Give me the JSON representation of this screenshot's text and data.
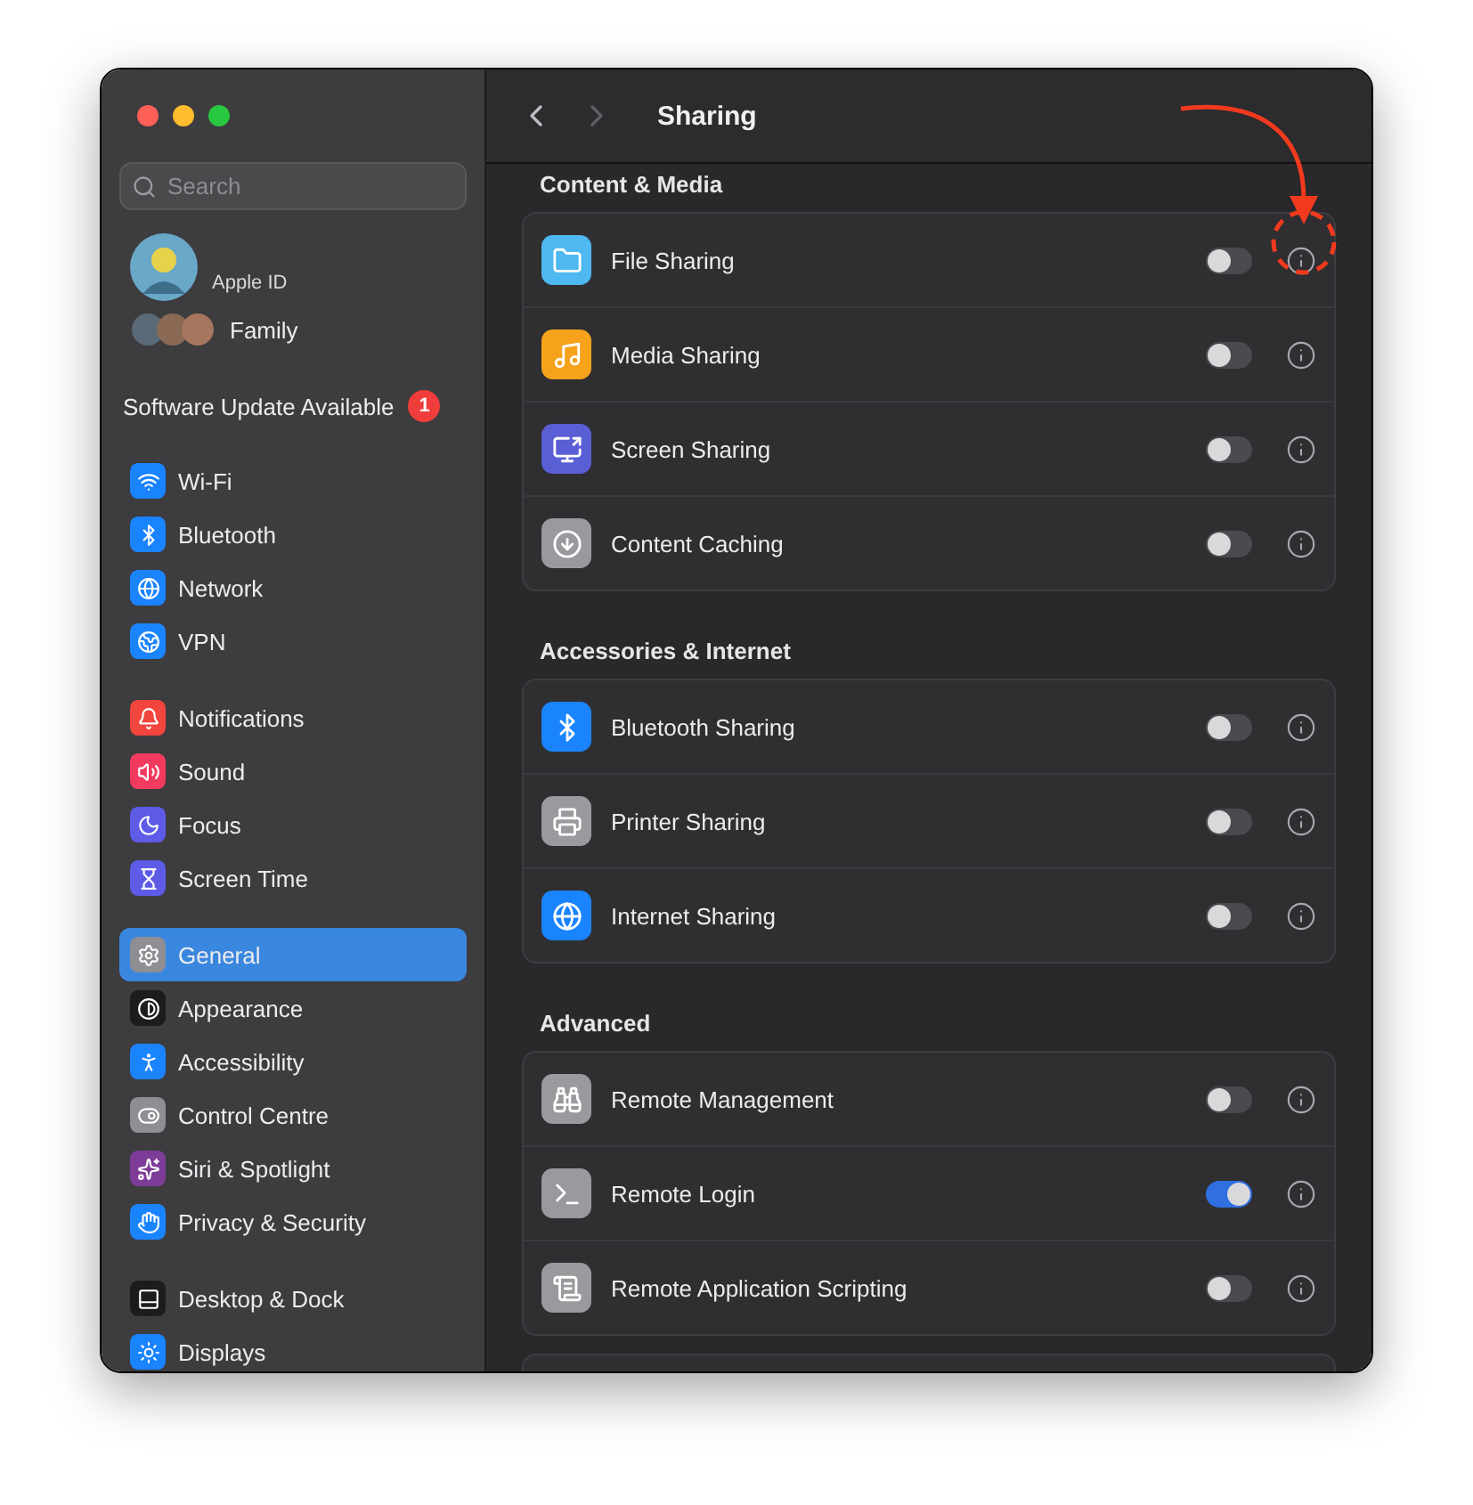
{
  "sidebar": {
    "search": {
      "placeholder": "Search"
    },
    "account": {
      "label": "Apple ID"
    },
    "family": {
      "label": "Family"
    },
    "update": {
      "label": "Software Update Available",
      "badge": "1"
    },
    "groups": [
      [
        {
          "label": "Wi-Fi",
          "kind": "wifi",
          "color": "#1a84ff",
          "selected": false
        },
        {
          "label": "Bluetooth",
          "kind": "bluetooth",
          "color": "#1a84ff",
          "selected": false
        },
        {
          "label": "Network",
          "kind": "globe",
          "color": "#1a84ff",
          "selected": false
        },
        {
          "label": "VPN",
          "kind": "vpn",
          "color": "#1a84ff",
          "selected": false
        }
      ],
      [
        {
          "label": "Notifications",
          "kind": "bell",
          "color": "#f2453d",
          "selected": false
        },
        {
          "label": "Sound",
          "kind": "sound",
          "color": "#f23a5f",
          "selected": false
        },
        {
          "label": "Focus",
          "kind": "moon",
          "color": "#5e5ce6",
          "selected": false
        },
        {
          "label": "Screen Time",
          "kind": "hourglass",
          "color": "#5e5ce6",
          "selected": false
        }
      ],
      [
        {
          "label": "General",
          "kind": "gear",
          "color": "#8e8e93",
          "selected": true
        },
        {
          "label": "Appearance",
          "kind": "contrast",
          "color": "#1c1c1e",
          "selected": false
        },
        {
          "label": "Accessibility",
          "kind": "person",
          "color": "#1a84ff",
          "selected": false
        },
        {
          "label": "Control Centre",
          "kind": "toggles",
          "color": "#8e8e93",
          "selected": false
        },
        {
          "label": "Siri & Spotlight",
          "kind": "sparkles",
          "color": "#7d3c98",
          "selected": false
        },
        {
          "label": "Privacy & Security",
          "kind": "hand",
          "color": "#1a84ff",
          "selected": false
        }
      ],
      [
        {
          "label": "Desktop & Dock",
          "kind": "dock",
          "color": "#1c1c1e",
          "selected": false
        },
        {
          "label": "Displays",
          "kind": "sun",
          "color": "#1a84ff",
          "selected": false
        }
      ]
    ]
  },
  "header": {
    "title": "Sharing"
  },
  "sections": [
    {
      "title": "Content & Media",
      "rows": [
        {
          "label": "File Sharing",
          "kind": "folder",
          "color": "#4fb8f0",
          "on": false
        },
        {
          "label": "Media Sharing",
          "kind": "music",
          "color": "#f7a21b",
          "on": false
        },
        {
          "label": "Screen Sharing",
          "kind": "screen",
          "color": "#5b5fd6",
          "on": false
        },
        {
          "label": "Content Caching",
          "kind": "download",
          "color": "#9a9a9e",
          "on": false
        }
      ]
    },
    {
      "title": "Accessories & Internet",
      "rows": [
        {
          "label": "Bluetooth Sharing",
          "kind": "bluetooth",
          "color": "#1a84ff",
          "on": false
        },
        {
          "label": "Printer Sharing",
          "kind": "printer",
          "color": "#9a9a9e",
          "on": false
        },
        {
          "label": "Internet Sharing",
          "kind": "globe",
          "color": "#1a84ff",
          "on": false
        }
      ]
    },
    {
      "title": "Advanced",
      "rows": [
        {
          "label": "Remote Management",
          "kind": "binoculars",
          "color": "#9a9a9e",
          "on": false
        },
        {
          "label": "Remote Login",
          "kind": "terminal",
          "color": "#9a9a9e",
          "on": true
        },
        {
          "label": "Remote Application Scripting",
          "kind": "script",
          "color": "#9a9a9e",
          "on": false
        }
      ]
    }
  ]
}
